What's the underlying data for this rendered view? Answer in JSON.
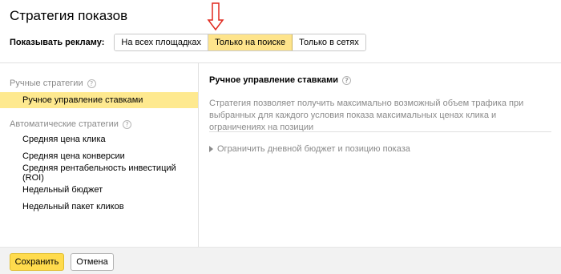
{
  "title": "Стратегия показов",
  "annotation_color": "#e0281e",
  "show_ads": {
    "label": "Показывать рекламу:",
    "options": [
      "На всех площадках",
      "Только на поиске",
      "Только в сетях"
    ],
    "selected": "Только на поиске"
  },
  "manual": {
    "group_label": "Ручные стратегии",
    "items": [
      "Ручное управление ставками"
    ],
    "selected": "Ручное управление ставками"
  },
  "auto": {
    "group_label": "Автоматические стратегии",
    "items": [
      "Средняя цена клика",
      "Средняя цена конверсии",
      "Средняя рентабельность инвестиций (ROI)",
      "Недельный бюджет",
      "Недельный пакет кликов"
    ]
  },
  "detail": {
    "title": "Ручное управление ставками",
    "description": "Стратегия позволяет получить максимально возможный объем трафика при выбранных для каждого условия показа максимальных ценах клика и ограничениях на позиции",
    "limit_link": "Ограничить дневной бюджет и позицию показа"
  },
  "footer": {
    "save": "Сохранить",
    "cancel": "Отмена"
  }
}
